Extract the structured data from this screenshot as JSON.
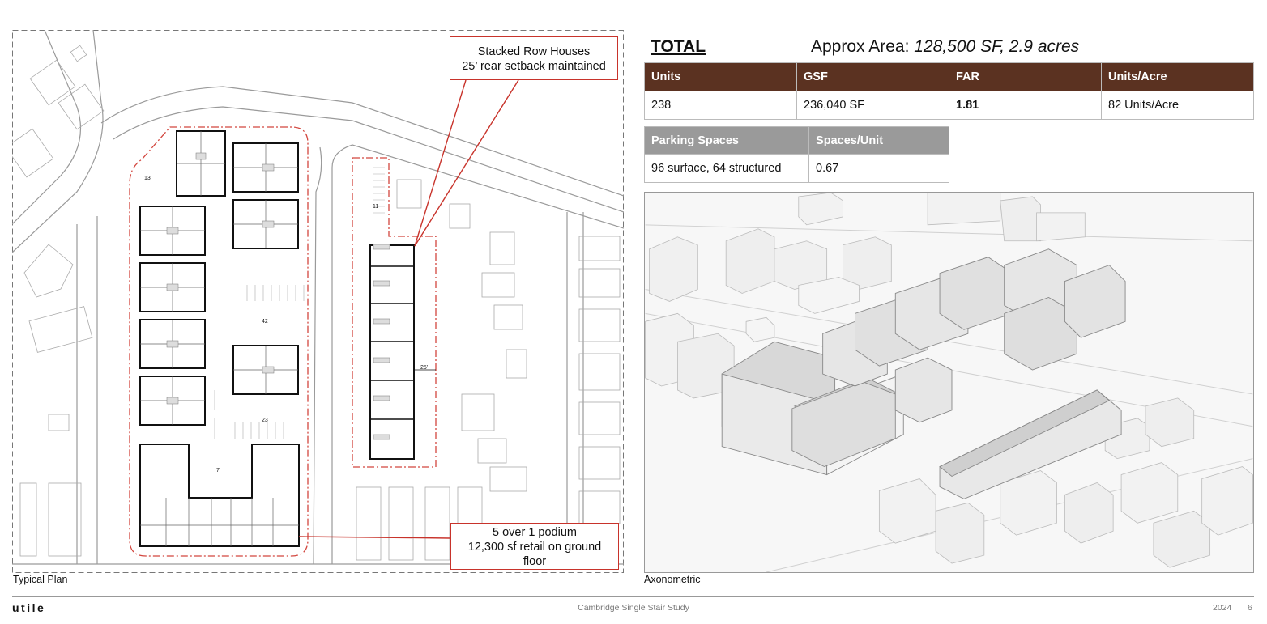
{
  "plan": {
    "caption": "Typical Plan",
    "callout_top": {
      "line1": "Stacked Row Houses",
      "line2": "25’ rear setback maintained"
    },
    "callout_bottom": {
      "line1": "5 over 1 podium",
      "line2": "12,300 sf retail on ground",
      "line3": "floor"
    },
    "parking_labels": [
      "13",
      "42",
      "23",
      "7",
      "11"
    ],
    "setback_label": "25'"
  },
  "summary": {
    "title": "TOTAL",
    "area_label": "Approx Area: ",
    "area_value": "128,500 SF,  2.9 acres"
  },
  "units_table": {
    "headers": [
      "Units",
      "GSF",
      "FAR",
      "Units/Acre"
    ],
    "row": [
      "238",
      "236,040 SF",
      "1.81",
      "82 Units/Acre"
    ],
    "header_color": "#5b3221"
  },
  "parking_table": {
    "headers": [
      "Parking Spaces",
      "Spaces/Unit"
    ],
    "row": [
      "96 surface, 64 structured",
      "0.67"
    ],
    "header_color": "#9a9a9a"
  },
  "axonometric": {
    "caption": "Axonometric"
  },
  "footer": {
    "logo": "utile",
    "center": "Cambridge Single Stair Study",
    "year": "2024",
    "page": "6"
  },
  "colors": {
    "callout_border": "#c8332b",
    "site_boundary": "#d2463e"
  }
}
